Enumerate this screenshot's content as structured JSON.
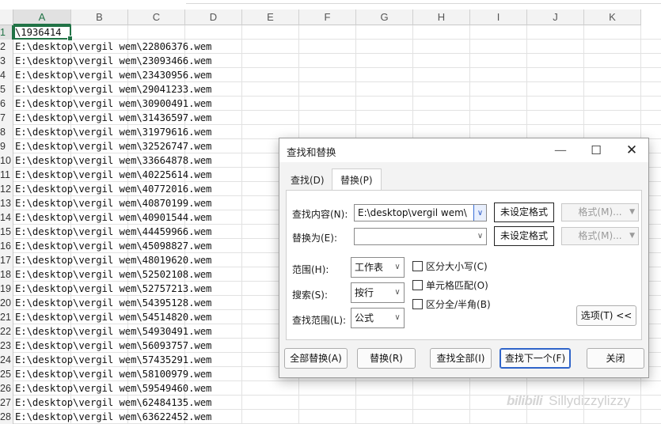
{
  "sheet": {
    "columns": [
      "A",
      "B",
      "C",
      "D",
      "E",
      "F",
      "G",
      "H",
      "I",
      "J",
      "K"
    ],
    "selected_column": "A",
    "row_numbers": [
      "1",
      "2",
      "3",
      "4",
      "5",
      "6",
      "7",
      "8",
      "9",
      "10",
      "11",
      "12",
      "13",
      "14",
      "15",
      "16",
      "17",
      "18",
      "19",
      "20",
      "21",
      "22",
      "23",
      "24",
      "25",
      "26",
      "27",
      "28"
    ],
    "rows": [
      "\\1936414",
      "E:\\desktop\\vergil wem\\22806376.wem",
      "E:\\desktop\\vergil wem\\23093466.wem",
      "E:\\desktop\\vergil wem\\23430956.wem",
      "E:\\desktop\\vergil wem\\29041233.wem",
      "E:\\desktop\\vergil wem\\30900491.wem",
      "E:\\desktop\\vergil wem\\31436597.wem",
      "E:\\desktop\\vergil wem\\31979616.wem",
      "E:\\desktop\\vergil wem\\32526747.wem",
      "E:\\desktop\\vergil wem\\33664878.wem",
      "E:\\desktop\\vergil wem\\40225614.wem",
      "E:\\desktop\\vergil wem\\40772016.wem",
      "E:\\desktop\\vergil wem\\40870199.wem",
      "E:\\desktop\\vergil wem\\40901544.wem",
      "E:\\desktop\\vergil wem\\44459966.wem",
      "E:\\desktop\\vergil wem\\45098827.wem",
      "E:\\desktop\\vergil wem\\48019620.wem",
      "E:\\desktop\\vergil wem\\52502108.wem",
      "E:\\desktop\\vergil wem\\52757213.wem",
      "E:\\desktop\\vergil wem\\54395128.wem",
      "E:\\desktop\\vergil wem\\54514820.wem",
      "E:\\desktop\\vergil wem\\54930491.wem",
      "E:\\desktop\\vergil wem\\56093757.wem",
      "E:\\desktop\\vergil wem\\57435291.wem",
      "E:\\desktop\\vergil wem\\58100979.wem",
      "E:\\desktop\\vergil wem\\59549460.wem",
      "E:\\desktop\\vergil wem\\62484135.wem",
      "E:\\desktop\\vergil wem\\63622452.wem"
    ]
  },
  "dialog": {
    "title": "查找和替换",
    "window_controls": {
      "minimize": "—",
      "maximize": "☐",
      "close": "✕"
    },
    "tabs": {
      "find": "查找(D)",
      "replace": "替换(P)"
    },
    "find_label": "查找内容(N):",
    "find_value": "E:\\desktop\\vergil wem\\",
    "replace_label": "替换为(E):",
    "replace_value": "",
    "format_not_set": "未设定格式",
    "format_button": "格式(M)...",
    "scope_label": "范围(H):",
    "scope_value": "工作表",
    "search_label": "搜索(S):",
    "search_value": "按行",
    "lookin_label": "查找范围(L):",
    "lookin_value": "公式",
    "match_case": "区分大小写(C)",
    "match_entire": "单元格匹配(O)",
    "match_width": "区分全/半角(B)",
    "options_button": "选项(T) <<",
    "buttons": {
      "replace_all": "全部替换(A)",
      "replace": "替换(R)",
      "find_all": "查找全部(I)",
      "find_next": "查找下一个(F)",
      "close": "关闭"
    }
  },
  "watermark": {
    "logo": "bilibili",
    "text": "Sillydizzylizzy"
  }
}
